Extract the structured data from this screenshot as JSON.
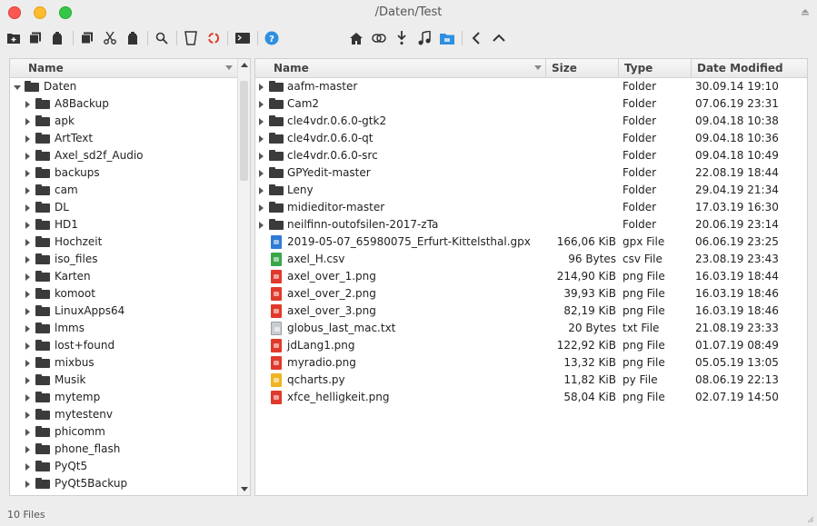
{
  "window": {
    "title": "/Daten/Test"
  },
  "toolbar": {
    "icons": [
      "new-folder-icon",
      "copy-icon",
      "paste-icon",
      "duplicate-icon",
      "cut-icon",
      "delete-icon",
      "search-icon",
      "trash-icon",
      "recycle-icon",
      "terminal-icon",
      "help-icon",
      "home-icon",
      "link-icon",
      "download-icon",
      "music-icon",
      "folder-icon",
      "back-icon",
      "up-icon"
    ],
    "help_glyph": "?",
    "accent": "#2f8fe0"
  },
  "tree": {
    "header": "Name",
    "root": "Daten",
    "items": [
      "A8Backup",
      "apk",
      "ArtText",
      "Axel_sd2f_Audio",
      "backups",
      "cam",
      "DL",
      "HD1",
      "Hochzeit",
      "iso_files",
      "Karten",
      "komoot",
      "LinuxApps64",
      "lmms",
      "lost+found",
      "mixbus",
      "Musik",
      "mytemp",
      "mytestenv",
      "phicomm",
      "phone_flash",
      "PyQt5",
      "PyQt5Backup"
    ]
  },
  "files": {
    "columns": {
      "name": "Name",
      "size": "Size",
      "type": "Type",
      "date": "Date Modified"
    },
    "rows": [
      {
        "name": "aafm-master",
        "size": "",
        "type": "Folder",
        "date": "30.09.14 19:10",
        "kind": "folder"
      },
      {
        "name": "Cam2",
        "size": "",
        "type": "Folder",
        "date": "07.06.19 23:31",
        "kind": "folder"
      },
      {
        "name": "cle4vdr.0.6.0-gtk2",
        "size": "",
        "type": "Folder",
        "date": "09.04.18 10:38",
        "kind": "folder"
      },
      {
        "name": "cle4vdr.0.6.0-qt",
        "size": "",
        "type": "Folder",
        "date": "09.04.18 10:36",
        "kind": "folder"
      },
      {
        "name": "cle4vdr.0.6.0-src",
        "size": "",
        "type": "Folder",
        "date": "09.04.18 10:49",
        "kind": "folder"
      },
      {
        "name": "GPYedit-master",
        "size": "",
        "type": "Folder",
        "date": "22.08.19 18:44",
        "kind": "folder"
      },
      {
        "name": "Leny",
        "size": "",
        "type": "Folder",
        "date": "29.04.19 21:34",
        "kind": "folder"
      },
      {
        "name": "midieditor-master",
        "size": "",
        "type": "Folder",
        "date": "17.03.19 16:30",
        "kind": "folder"
      },
      {
        "name": "neilfinn-outofsilen-2017-zTa",
        "size": "",
        "type": "Folder",
        "date": "20.06.19 23:14",
        "kind": "folder"
      },
      {
        "name": "2019-05-07_65980075_Erfurt-Kittelsthal.gpx",
        "size": "166,06 KiB",
        "type": "gpx File",
        "date": "06.06.19 23:25",
        "kind": "gpx"
      },
      {
        "name": "axel_H.csv",
        "size": "96 Bytes",
        "type": "csv File",
        "date": "23.08.19 23:43",
        "kind": "csv"
      },
      {
        "name": "axel_over_1.png",
        "size": "214,90 KiB",
        "type": "png File",
        "date": "16.03.19 18:44",
        "kind": "png"
      },
      {
        "name": "axel_over_2.png",
        "size": "39,93 KiB",
        "type": "png File",
        "date": "16.03.19 18:46",
        "kind": "png"
      },
      {
        "name": "axel_over_3.png",
        "size": "82,19 KiB",
        "type": "png File",
        "date": "16.03.19 18:46",
        "kind": "png"
      },
      {
        "name": "globus_last_mac.txt",
        "size": "20 Bytes",
        "type": "txt File",
        "date": "21.08.19 23:33",
        "kind": "txt"
      },
      {
        "name": "jdLang1.png",
        "size": "122,92 KiB",
        "type": "png File",
        "date": "01.07.19 08:49",
        "kind": "png"
      },
      {
        "name": "myradio.png",
        "size": "13,32 KiB",
        "type": "png File",
        "date": "05.05.19 13:05",
        "kind": "png"
      },
      {
        "name": "qcharts.py",
        "size": "11,82 KiB",
        "type": "py File",
        "date": "08.06.19 22:13",
        "kind": "py"
      },
      {
        "name": "xfce_helligkeit.png",
        "size": "58,04 KiB",
        "type": "png File",
        "date": "02.07.19 14:50",
        "kind": "png"
      }
    ]
  },
  "status": {
    "text": "10 Files"
  }
}
